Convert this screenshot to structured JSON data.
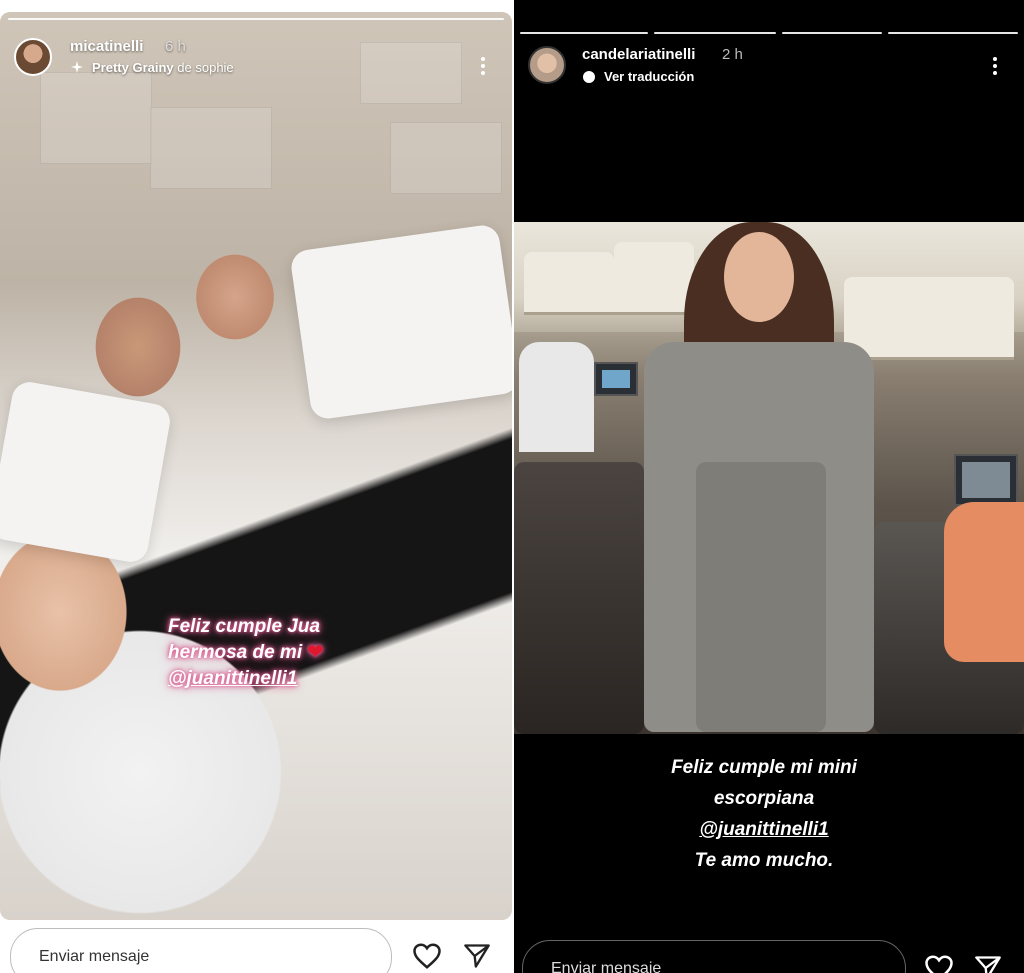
{
  "left_story": {
    "username": "micatinelli",
    "time": "6 h",
    "filter_label": "Pretty Grainy",
    "filter_credit": "de sophie",
    "caption_line1": "Feliz cumple Jua",
    "caption_line2": "hermosa de mi",
    "caption_heart": "❤",
    "caption_tag": "@juanittinelli1",
    "message_placeholder": "Enviar mensaje"
  },
  "right_story": {
    "username": "candelariatinelli",
    "time": "2 h",
    "translate_label": "Ver traducción",
    "caption_line1": "Feliz cumple mi mini",
    "caption_line2": "escorpiana",
    "caption_tag": "@juanittinelli1",
    "caption_line4": "Te amo mucho.",
    "message_placeholder": "Enviar mensaje"
  },
  "icons": {
    "like": "heart-icon",
    "share": "send-icon",
    "more": "more-icon",
    "filter": "sparkle-icon",
    "translate": "translate-icon"
  },
  "colors": {
    "tag_glow": "#d95a8e",
    "heart": "#e0182d",
    "right_background": "#000000"
  }
}
